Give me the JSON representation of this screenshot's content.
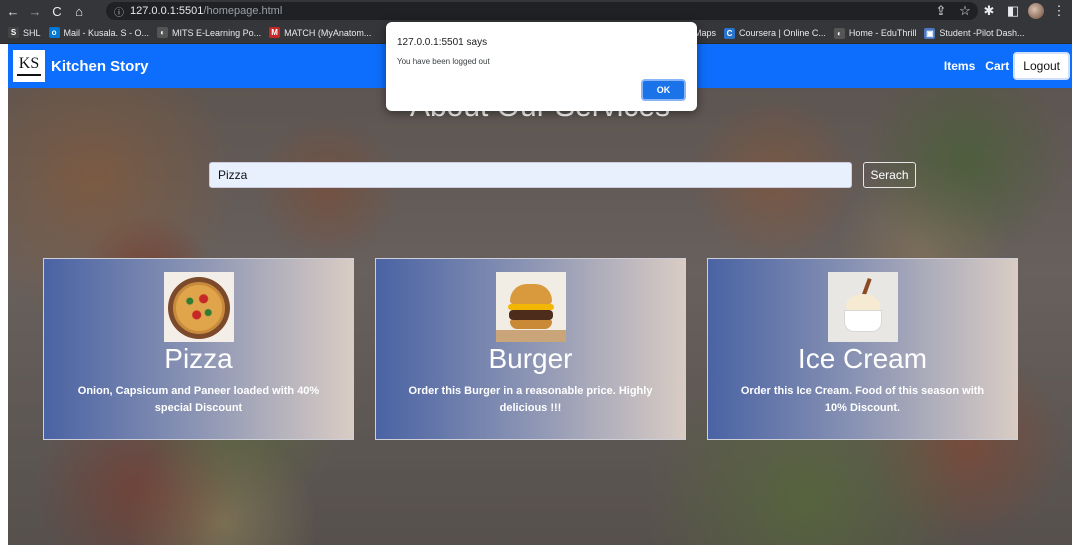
{
  "browser": {
    "url_host": "127.0.0.1:5501",
    "url_path": "/homepage.html",
    "bookmarks": [
      {
        "label": "SHL",
        "icon": "shl-icon",
        "color": "#444444",
        "glyph": "S"
      },
      {
        "label": "Mail - Kusala. S - O...",
        "icon": "outlook-icon",
        "color": "#0078d4",
        "glyph": "o"
      },
      {
        "label": "MITS E-Learning Po...",
        "icon": "moodle-icon",
        "color": "#555555",
        "glyph": "◐"
      },
      {
        "label": "MATCH (MyAnatom...",
        "icon": "match-icon",
        "color": "#c62828",
        "glyph": "M"
      }
    ],
    "bookmarks_right": [
      {
        "label": "Maps",
        "icon": "maps-icon",
        "color": "#35363a",
        "glyph": ""
      },
      {
        "label": "Coursera | Online C...",
        "icon": "coursera-icon",
        "color": "#2a73cc",
        "glyph": "C"
      },
      {
        "label": "Home - EduThrill",
        "icon": "edu-icon",
        "color": "#555555",
        "glyph": "◐"
      },
      {
        "label": "Student -Pilot Dash...",
        "icon": "student-icon",
        "color": "#4a78c2",
        "glyph": "▣"
      }
    ]
  },
  "navbar": {
    "logo_text": "KS",
    "brand": "Kitchen Story",
    "items_label": "Items",
    "cart_label": "Cart",
    "logout_label": "Logout",
    "color": "#0d6efd"
  },
  "main": {
    "section_title": "About Our Services",
    "search_value": "Pizza",
    "search_button": "Serach"
  },
  "cards": [
    {
      "title": "Pizza",
      "desc": "Onion, Capsicum and Paneer loaded with 40% special Discount"
    },
    {
      "title": "Burger",
      "desc": "Order this Burger in a reasonable price. Highly delicious !!!"
    },
    {
      "title": "Ice Cream",
      "desc": "Order this Ice Cream. Food of this season with 10% Discount."
    }
  ],
  "alert": {
    "title": "127.0.0.1:5501 says",
    "message": "You have been logged out",
    "ok_label": "OK"
  }
}
